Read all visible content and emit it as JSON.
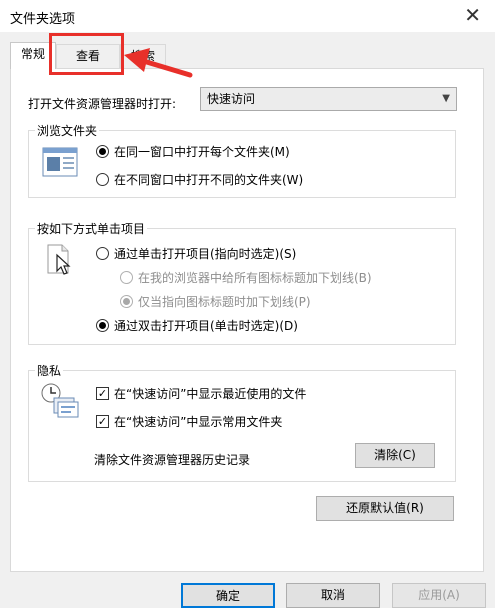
{
  "window": {
    "title": "文件夹选项",
    "close_icon": "close-icon"
  },
  "tabs": [
    {
      "label": "常规",
      "active": true
    },
    {
      "label": "查看",
      "active": false,
      "highlighted": true
    },
    {
      "label": "搜索",
      "active": false
    }
  ],
  "general": {
    "open_label": "打开文件资源管理器时打开:",
    "open_value": "快速访问",
    "browse": {
      "title": "浏览文件夹",
      "options": [
        {
          "label": "在同一窗口中打开每个文件夹(M)",
          "selected": true
        },
        {
          "label": "在不同窗口中打开不同的文件夹(W)",
          "selected": false
        }
      ]
    },
    "click": {
      "title": "按如下方式单击项目",
      "single": {
        "label": "通过单击打开项目(指向时选定)(S)",
        "selected": false
      },
      "underline_all": {
        "label": "在我的浏览器中给所有图标标题加下划线(B)",
        "selected": false,
        "disabled": true
      },
      "underline_point": {
        "label": "仅当指向图标标题时加下划线(P)",
        "selected": true,
        "disabled": true
      },
      "double": {
        "label": "通过双击打开项目(单击时选定)(D)",
        "selected": true
      }
    },
    "privacy": {
      "title": "隐私",
      "recent_files": {
        "label": "在“快速访问”中显示最近使用的文件",
        "checked": true
      },
      "frequent_folders": {
        "label": "在“快速访问”中显示常用文件夹",
        "checked": true
      },
      "clear_label": "清除文件资源管理器历史记录",
      "clear_button": "清除(C)"
    },
    "restore_button": "还原默认值(R)"
  },
  "footer": {
    "ok": "确定",
    "cancel": "取消",
    "apply": "应用(A)"
  },
  "colors": {
    "annotation": "#e8302a",
    "default_button_border": "#0078d7"
  }
}
